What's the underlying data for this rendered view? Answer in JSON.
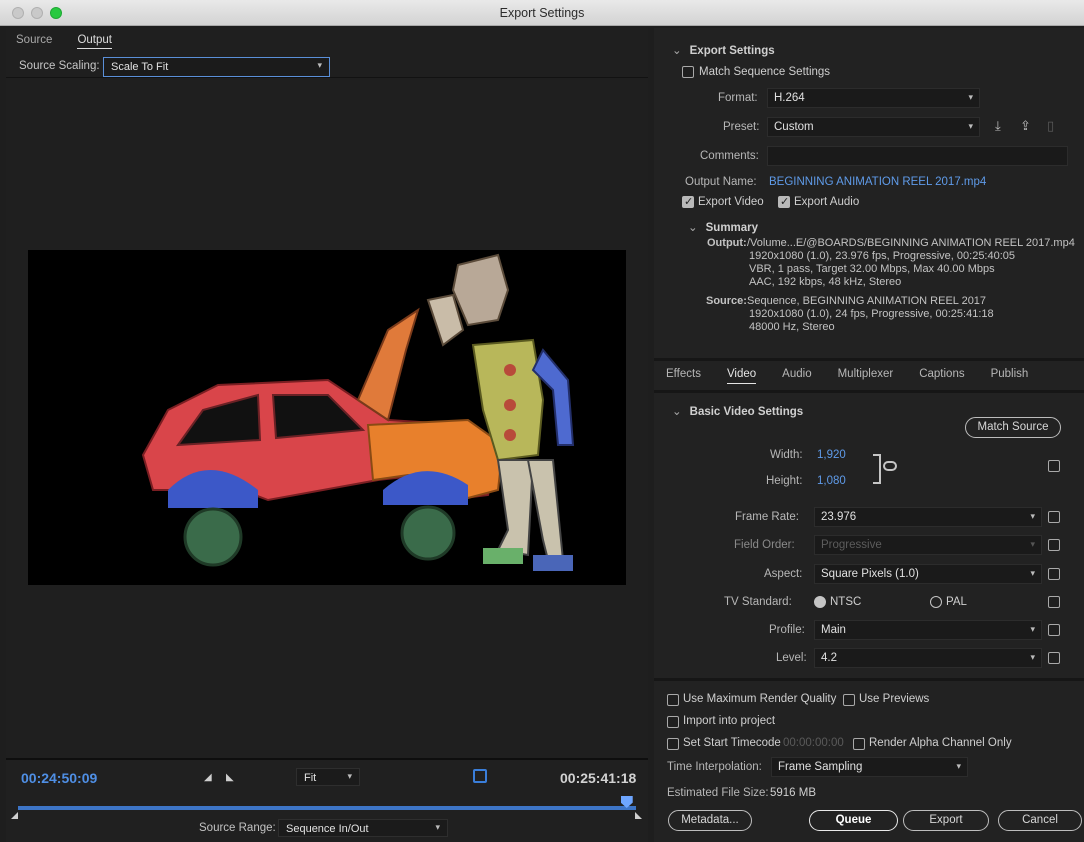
{
  "window": {
    "title": "Export Settings"
  },
  "left": {
    "tabs": [
      {
        "label": "Source"
      },
      {
        "label": "Output"
      }
    ],
    "source_scaling": {
      "label": "Source Scaling:",
      "value": "Scale To Fit"
    },
    "timecode_in": "00:24:50:09",
    "timecode_out": "00:25:41:18",
    "zoom": {
      "value": "Fit"
    },
    "source_range": {
      "label": "Source Range:",
      "value": "Sequence In/Out"
    },
    "playhead_fraction": 0.985
  },
  "export_settings": {
    "header": "Export Settings",
    "match_sequence": "Match Sequence Settings",
    "format_label": "Format:",
    "format": "H.264",
    "preset_label": "Preset:",
    "preset": "Custom",
    "comments_label": "Comments:",
    "comments": "",
    "output_name_label": "Output Name:",
    "output_name": "BEGINNING ANIMATION REEL 2017.mp4",
    "export_video": "Export Video",
    "export_audio": "Export Audio",
    "summary": {
      "header": "Summary",
      "output_label": "Output:",
      "output_lines": [
        "/Volume...E/@BOARDS/BEGINNING ANIMATION REEL 2017.mp4",
        "1920x1080 (1.0), 23.976 fps, Progressive, 00:25:40:05",
        "VBR, 1 pass, Target 32.00 Mbps, Max 40.00 Mbps",
        "AAC, 192 kbps, 48 kHz, Stereo"
      ],
      "source_label": "Source:",
      "source_lines": [
        "Sequence, BEGINNING ANIMATION REEL 2017",
        "1920x1080 (1.0), 24 fps, Progressive, 00:25:41:18",
        "48000 Hz, Stereo"
      ]
    }
  },
  "tabs": [
    {
      "label": "Effects"
    },
    {
      "label": "Video"
    },
    {
      "label": "Audio"
    },
    {
      "label": "Multiplexer"
    },
    {
      "label": "Captions"
    },
    {
      "label": "Publish"
    }
  ],
  "video": {
    "header": "Basic Video Settings",
    "match_source": "Match Source",
    "width_label": "Width:",
    "width": "1,920",
    "height_label": "Height:",
    "height": "1,080",
    "frame_rate_label": "Frame Rate:",
    "frame_rate": "23.976",
    "field_order_label": "Field Order:",
    "field_order": "Progressive",
    "aspect_label": "Aspect:",
    "aspect": "Square Pixels (1.0)",
    "tv_standard_label": "TV Standard:",
    "ntsc": "NTSC",
    "pal": "PAL",
    "profile_label": "Profile:",
    "profile": "Main",
    "level_label": "Level:",
    "level": "4.2"
  },
  "bottom": {
    "max_render": "Use Maximum Render Quality",
    "use_previews": "Use Previews",
    "import_project": "Import into project",
    "set_start_tc": "Set Start Timecode",
    "start_tc_value": "00:00:00:00",
    "render_alpha": "Render Alpha Channel Only",
    "time_interp_label": "Time Interpolation:",
    "time_interp": "Frame Sampling",
    "file_size_label": "Estimated File Size:",
    "file_size": "5916 MB",
    "buttons": {
      "metadata": "Metadata...",
      "queue": "Queue",
      "export": "Export",
      "cancel": "Cancel"
    }
  }
}
